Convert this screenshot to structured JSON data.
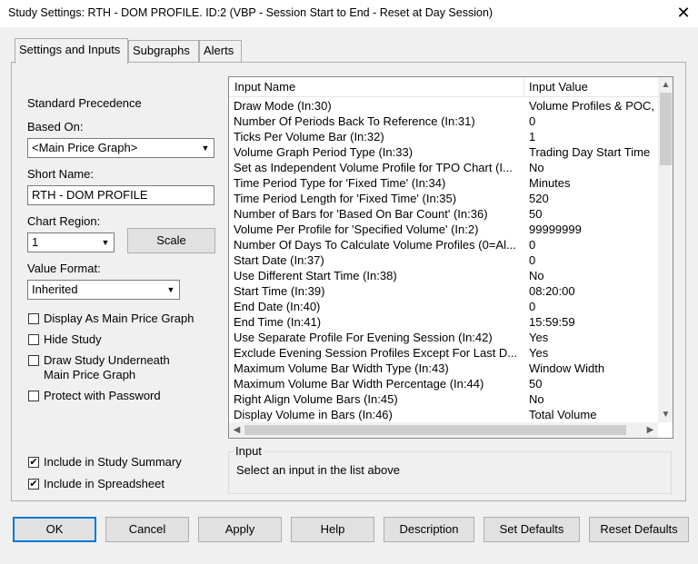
{
  "window": {
    "title": "Study Settings: RTH - DOM PROFILE. ID:2 (VBP - Session Start to End - Reset at Day Session)",
    "close_glyph": "✕"
  },
  "tabs": [
    {
      "label": "Settings and Inputs",
      "active": true
    },
    {
      "label": "Subgraphs",
      "active": false
    },
    {
      "label": "Alerts",
      "active": false
    }
  ],
  "left": {
    "standard_precedence": "Standard Precedence",
    "based_on_label": "Based On:",
    "based_on_value": "<Main Price Graph>",
    "short_name_label": "Short Name:",
    "short_name_value": "RTH - DOM PROFILE",
    "chart_region_label": "Chart Region:",
    "chart_region_value": "1",
    "scale_button": "Scale",
    "value_format_label": "Value Format:",
    "value_format_value": "Inherited",
    "checkboxes": {
      "display_as_main": {
        "label": "Display As Main Price Graph",
        "checked": false
      },
      "hide_study": {
        "label": "Hide Study",
        "checked": false
      },
      "draw_underneath_1": "Draw Study Underneath",
      "draw_underneath_2": "Main Price Graph",
      "draw_underneath_checked": false,
      "protect": {
        "label": "Protect with Password",
        "checked": false
      },
      "include_summary": {
        "label": "Include in Study Summary",
        "checked": true
      },
      "include_spreadsheet": {
        "label": "Include in Spreadsheet",
        "checked": true
      }
    }
  },
  "inputs_grid": {
    "headers": [
      "Input Name",
      "Input Value"
    ],
    "rows": [
      {
        "name": "Draw Mode   (In:30)",
        "value": "Volume Profiles & POC,"
      },
      {
        "name": "Number Of Periods Back To Reference   (In:31)",
        "value": "0"
      },
      {
        "name": "Ticks Per Volume Bar   (In:32)",
        "value": "1"
      },
      {
        "name": "Volume Graph Period Type   (In:33)",
        "value": "Trading Day Start Time"
      },
      {
        "name": "Set as Independent Volume Profile for TPO Chart   (I...",
        "value": "No"
      },
      {
        "name": "Time Period Type for 'Fixed Time'   (In:34)",
        "value": "Minutes"
      },
      {
        "name": "Time Period Length for 'Fixed Time'   (In:35)",
        "value": "520"
      },
      {
        "name": "Number of Bars for 'Based On Bar Count'   (In:36)",
        "value": "50"
      },
      {
        "name": "Volume Per Profile for 'Specified Volume'   (In:2)",
        "value": "99999999"
      },
      {
        "name": "Number Of Days To Calculate Volume Profiles (0=Al...",
        "value": "0"
      },
      {
        "name": "Start Date   (In:37)",
        "value": "0"
      },
      {
        "name": "Use Different Start Time   (In:38)",
        "value": "No"
      },
      {
        "name": "Start Time   (In:39)",
        "value": "08:20:00"
      },
      {
        "name": "End Date   (In:40)",
        "value": "0"
      },
      {
        "name": "End Time   (In:41)",
        "value": "15:59:59"
      },
      {
        "name": "Use Separate Profile For Evening Session   (In:42)",
        "value": "Yes"
      },
      {
        "name": "Exclude Evening Session Profiles Except For Last D...",
        "value": "Yes"
      },
      {
        "name": "Maximum Volume Bar Width Type   (In:43)",
        "value": "Window Width"
      },
      {
        "name": "Maximum Volume Bar Width Percentage   (In:44)",
        "value": "50"
      },
      {
        "name": "Right Align Volume Bars   (In:45)",
        "value": "No"
      },
      {
        "name": "Display Volume in Bars   (In:46)",
        "value": "Total Volume"
      }
    ]
  },
  "input_group": {
    "title": "Input",
    "text": "Select an input in the list above"
  },
  "buttons": {
    "ok": "OK",
    "cancel": "Cancel",
    "apply": "Apply",
    "help": "Help",
    "description": "Description",
    "set_defaults": "Set Defaults",
    "reset_defaults": "Reset Defaults"
  },
  "icons": {
    "dropdown": "chevron-down-icon",
    "scroll_up": "scroll-up-arrow-icon",
    "scroll_down": "scroll-down-arrow-icon",
    "scroll_left": "scroll-left-arrow-icon",
    "scroll_right": "scroll-right-arrow-icon",
    "check": "checkmark-icon"
  },
  "colors": {
    "dialog_bg": "#f0f0f0",
    "default_button_border": "#0078d7"
  }
}
